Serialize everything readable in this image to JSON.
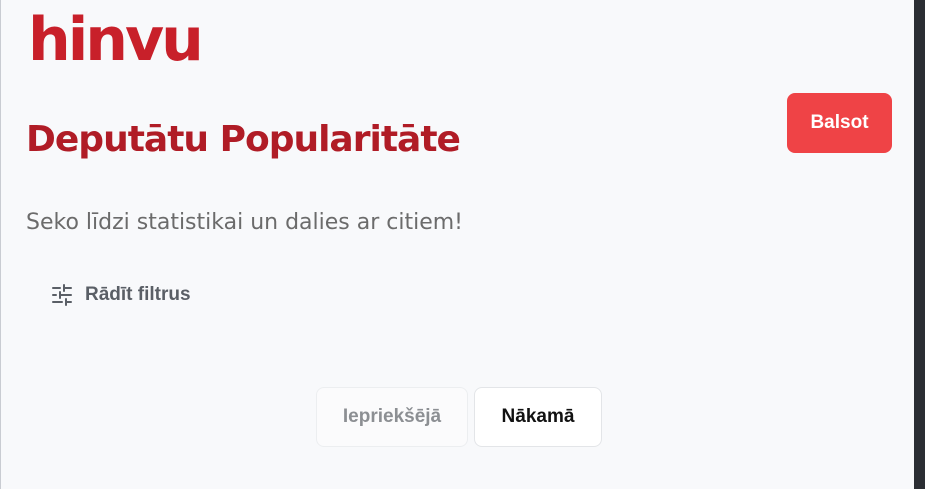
{
  "brand": {
    "logo_text": "hinvu",
    "accent_color": "#c8202a"
  },
  "header": {
    "title": "Deputātu Popularitāte",
    "vote_button_label": "Balsot",
    "subtitle": "Seko līdzi statistikai un dalies ar citiem!"
  },
  "filters": {
    "toggle_label": "Rādīt filtrus",
    "icon": "sliders-icon"
  },
  "pagination": {
    "previous_label": "Iepriekšējā",
    "next_label": "Nākamā",
    "previous_disabled": true
  },
  "colors": {
    "primary_button": "#ef4346",
    "title": "#b01c26",
    "background": "#f8f9fb"
  }
}
